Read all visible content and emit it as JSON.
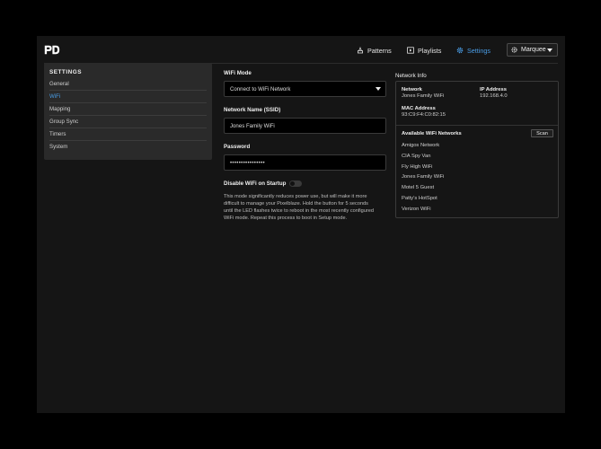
{
  "header": {
    "nav": [
      {
        "label": "Patterns",
        "icon": "patterns-icon"
      },
      {
        "label": "Playlists",
        "icon": "playlists-icon"
      },
      {
        "label": "Settings",
        "icon": "settings-icon",
        "active": true
      }
    ],
    "device": "Marquee",
    "accent_color": "#4a9ee8"
  },
  "sidebar": {
    "title": "SETTINGS",
    "items": [
      {
        "label": "General"
      },
      {
        "label": "WiFi",
        "active": true
      },
      {
        "label": "Mapping"
      },
      {
        "label": "Group Sync"
      },
      {
        "label": "Timers"
      },
      {
        "label": "System"
      }
    ]
  },
  "wifi": {
    "mode_label": "WiFi Mode",
    "mode_value": "Connect to WiFi Network",
    "ssid_label": "Network Name (SSID)",
    "ssid_value": "Jones Family WiFi",
    "password_label": "Password",
    "password_value": "••••••••••••••••",
    "disable_label": "Disable WiFi on Startup",
    "disable_enabled": false,
    "help_text": "This mode significantly reduces power use, but will make it more difficult to manage your Pixelblaze. Hold the button for 5 seconds until the LED flashes twice to reboot in the most recently configured WiFi mode. Repeat this process to boot in Setup mode."
  },
  "network_info": {
    "title": "Network Info",
    "network_label": "Network",
    "network_value": "Jones Family WiFi",
    "ip_label": "IP Address",
    "ip_value": "192.168.4.0",
    "mac_label": "MAC Address",
    "mac_value": "93:C9:F4:C0:82:15",
    "available_label": "Available WiFi Networks",
    "scan_label": "Scan",
    "networks": [
      "Amigos Network",
      "CIA Spy Van",
      "Fly High WiFi",
      "Jones Family WiFi",
      "Motel 5 Guest",
      "Patty's HotSpot",
      "Verizon WiFi"
    ]
  }
}
